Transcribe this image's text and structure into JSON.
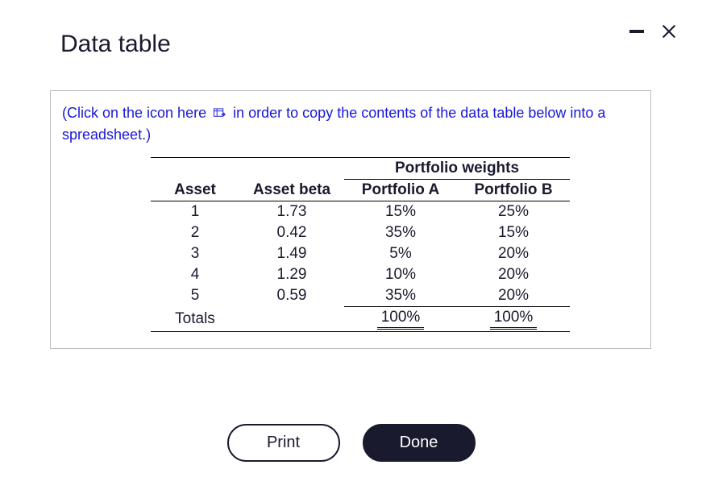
{
  "title": "Data table",
  "instruction": {
    "prefix": "(Click on the icon here",
    "suffix": "in order to copy the contents of the data table below into a spreadsheet.)"
  },
  "table": {
    "super_header": "Portfolio weights",
    "headers": {
      "asset": "Asset",
      "beta": "Asset beta",
      "pa": "Portfolio A",
      "pb": "Portfolio B"
    },
    "rows": [
      {
        "asset": "1",
        "beta": "1.73",
        "pa": "15%",
        "pb": "25%"
      },
      {
        "asset": "2",
        "beta": "0.42",
        "pa": "35%",
        "pb": "15%"
      },
      {
        "asset": "3",
        "beta": "1.49",
        "pa": "5%",
        "pb": "20%"
      },
      {
        "asset": "4",
        "beta": "1.29",
        "pa": "10%",
        "pb": "20%"
      },
      {
        "asset": "5",
        "beta": "0.59",
        "pa": "35%",
        "pb": "20%"
      }
    ],
    "totals": {
      "label": "Totals",
      "pa": "100%",
      "pb": "100%"
    }
  },
  "buttons": {
    "print": "Print",
    "done": "Done"
  }
}
